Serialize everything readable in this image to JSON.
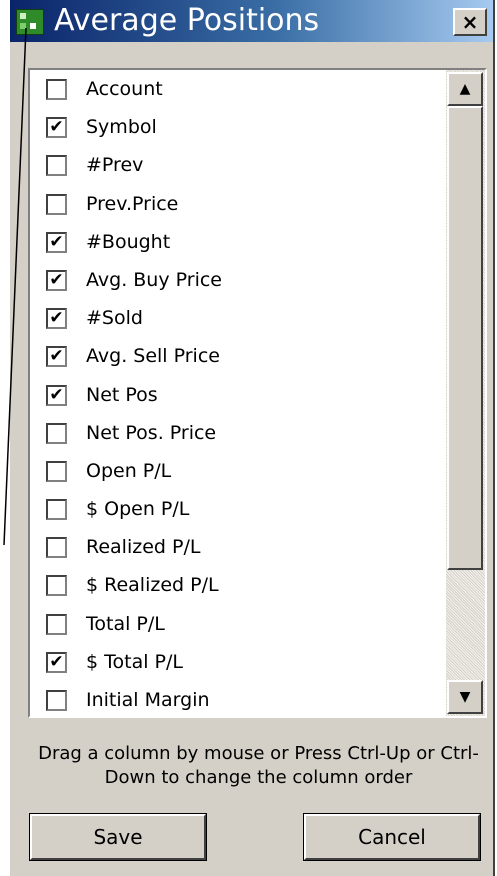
{
  "window": {
    "title": "Average Positions",
    "close_label": "×",
    "icon": "app-logo-icon"
  },
  "columns": [
    {
      "label": "Account",
      "checked": false
    },
    {
      "label": "Symbol",
      "checked": true
    },
    {
      "label": "#Prev",
      "checked": false
    },
    {
      "label": "Prev.Price",
      "checked": false
    },
    {
      "label": "#Bought",
      "checked": true
    },
    {
      "label": "Avg. Buy Price",
      "checked": true
    },
    {
      "label": "#Sold",
      "checked": true
    },
    {
      "label": "Avg. Sell Price",
      "checked": true
    },
    {
      "label": "Net Pos",
      "checked": true
    },
    {
      "label": "Net Pos. Price",
      "checked": false
    },
    {
      "label": "Open P/L",
      "checked": false
    },
    {
      "label": "$ Open P/L",
      "checked": false
    },
    {
      "label": "Realized P/L",
      "checked": false
    },
    {
      "label": "$ Realized P/L",
      "checked": false
    },
    {
      "label": "Total P/L",
      "checked": false
    },
    {
      "label": "$ Total P/L",
      "checked": true
    },
    {
      "label": "Initial Margin",
      "checked": false
    }
  ],
  "check_mark": "✔",
  "scrollbar": {
    "up_arrow": "▲",
    "down_arrow": "▼",
    "position": 0
  },
  "hint": "Drag a column by mouse or Press Ctrl-Up or Ctrl-Down to change the column order",
  "buttons": {
    "save_label": "Save",
    "cancel_label": "Cancel"
  }
}
